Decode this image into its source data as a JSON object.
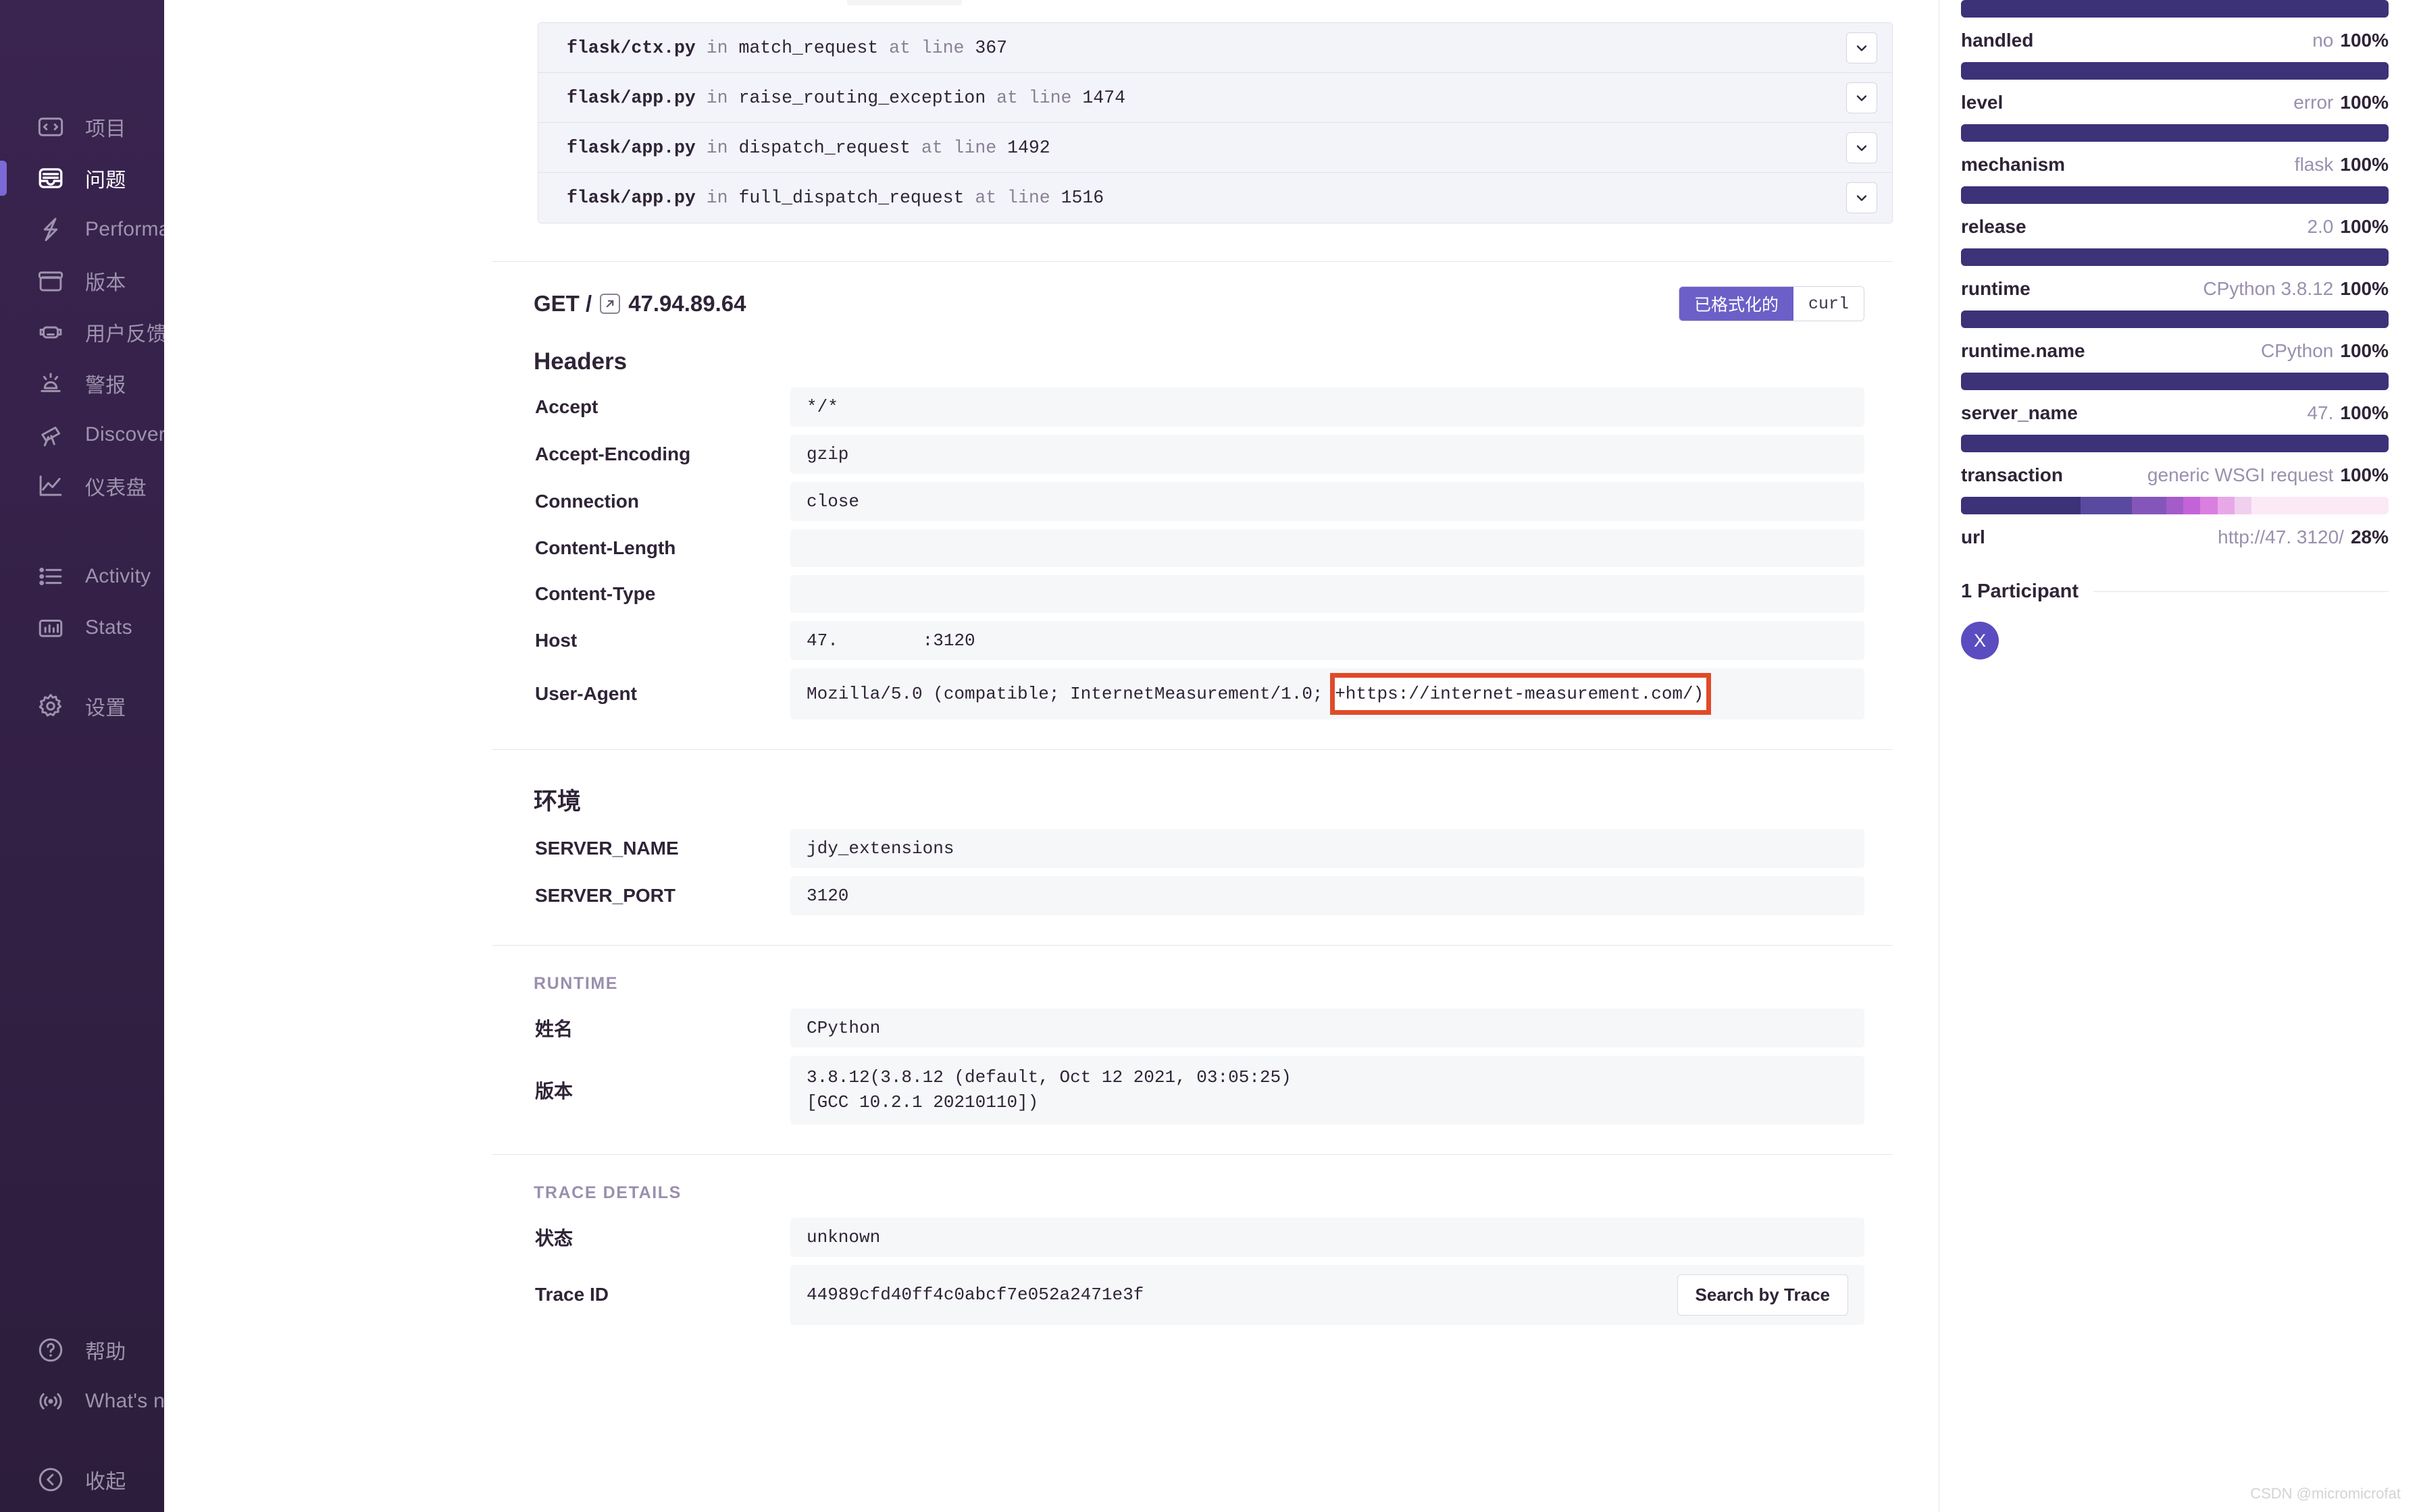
{
  "sidebar": {
    "primary_items": [
      {
        "label": "项目",
        "icon": "projects-icon",
        "active": false
      },
      {
        "label": "问题",
        "icon": "issues-icon",
        "active": true
      },
      {
        "label": "Performance",
        "icon": "lightning-icon",
        "active": false
      },
      {
        "label": "版本",
        "icon": "releases-box-icon",
        "active": false
      },
      {
        "label": "用户反馈",
        "icon": "user-feedback-icon",
        "active": false
      },
      {
        "label": "警报",
        "icon": "siren-alert-icon",
        "active": false
      },
      {
        "label": "Discover",
        "icon": "telescope-icon",
        "active": false
      },
      {
        "label": "仪表盘",
        "icon": "dashboard-chart-icon",
        "active": false
      }
    ],
    "secondary_items": [
      {
        "label": "Activity",
        "icon": "activity-list-icon",
        "active": false
      },
      {
        "label": "Stats",
        "icon": "stats-bars-icon",
        "active": false
      }
    ],
    "tertiary_items": [
      {
        "label": "设置",
        "icon": "gear-icon",
        "active": false
      }
    ],
    "bottom_items": [
      {
        "label": "帮助",
        "icon": "question-circle-icon"
      },
      {
        "label": "What's new",
        "icon": "broadcast-icon"
      },
      {
        "label": "收起",
        "icon": "chevron-left-circle-icon"
      }
    ]
  },
  "stack_frames": [
    {
      "file": "flask/ctx.py",
      "in": "in",
      "func": "match_request",
      "at": "at line",
      "line": "367"
    },
    {
      "file": "flask/app.py",
      "in": "in",
      "func": "raise_routing_exception",
      "at": "at line",
      "line": "1474"
    },
    {
      "file": "flask/app.py",
      "in": "in",
      "func": "dispatch_request",
      "at": "at line",
      "line": "1492"
    },
    {
      "file": "flask/app.py",
      "in": "in",
      "func": "full_dispatch_request",
      "at": "at line",
      "line": "1516"
    }
  ],
  "request": {
    "method_path": "GET /",
    "host": "47.94.89.64",
    "toggle": {
      "formatted": "已格式化的",
      "curl": "curl",
      "selected": "已格式化的"
    },
    "headers_title": "Headers",
    "headers": [
      {
        "key": "Accept",
        "value": "*/*"
      },
      {
        "key": "Accept-Encoding",
        "value": "gzip"
      },
      {
        "key": "Connection",
        "value": "close"
      },
      {
        "key": "Content-Length",
        "value": ""
      },
      {
        "key": "Content-Type",
        "value": ""
      },
      {
        "key": "Host",
        "value": "47.        :3120"
      }
    ],
    "user_agent": {
      "key": "User-Agent",
      "value_prefix": "Mozilla/5.0 (compatible; InternetMeasurement/1.0; ",
      "value_highlighted": "+https://internet-measurement.com/)"
    }
  },
  "environment": {
    "title": "环境",
    "rows": [
      {
        "key": "SERVER_NAME",
        "value": "jdy_extensions"
      },
      {
        "key": "SERVER_PORT",
        "value": "3120"
      }
    ]
  },
  "runtime": {
    "title": "RUNTIME",
    "rows": [
      {
        "key": "姓名",
        "value": "CPython"
      },
      {
        "key": "版本",
        "value": "3.8.12(3.8.12 (default, Oct 12 2021, 03:05:25)\n[GCC 10.2.1 20210110])"
      }
    ]
  },
  "trace_details": {
    "title": "TRACE DETAILS",
    "rows": [
      {
        "key": "状态",
        "value": "unknown"
      },
      {
        "key": "Trace ID",
        "value": "44989cfd40ff4c0abcf7e052a2471e3f"
      }
    ],
    "search_button": "Search by Trace"
  },
  "tags": [
    {
      "name": "handled",
      "value": "no",
      "percent": "100%",
      "fill": 100
    },
    {
      "name": "level",
      "value": "error",
      "percent": "100%",
      "fill": 100
    },
    {
      "name": "mechanism",
      "value": "flask",
      "percent": "100%",
      "fill": 100
    },
    {
      "name": "release",
      "value": "2.0",
      "percent": "100%",
      "fill": 100
    },
    {
      "name": "runtime",
      "value": "CPython 3.8.12",
      "percent": "100%",
      "fill": 100
    },
    {
      "name": "runtime.name",
      "value": "CPython",
      "percent": "100%",
      "fill": 100
    },
    {
      "name": "server_name",
      "value": "47.",
      "percent": "100%",
      "fill": 100
    },
    {
      "name": "transaction",
      "value": "generic WSGI request",
      "percent": "100%",
      "fill": 100
    },
    {
      "name": "url",
      "value": "http://47.        3120/",
      "percent": "28%",
      "fill": 28
    }
  ],
  "url_tag_segments": [
    {
      "width": 28,
      "color": "#3c3278"
    },
    {
      "width": 12,
      "color": "#594aa0"
    },
    {
      "width": 8,
      "color": "#8556ba"
    },
    {
      "width": 4,
      "color": "#a45cc8"
    },
    {
      "width": 4,
      "color": "#c264d8"
    },
    {
      "width": 4,
      "color": "#d97fe0"
    },
    {
      "width": 4,
      "color": "#e8a8e8"
    },
    {
      "width": 4,
      "color": "#f1cfee"
    },
    {
      "width": 32,
      "color": "#fbeaf6"
    }
  ],
  "participants": {
    "title": "1 Participant",
    "avatars": [
      "X"
    ]
  },
  "watermark": "CSDN @micromicrofat",
  "colors": {
    "sidebar_bg": "#2f1f3d",
    "accent_purple": "#6c5fc7",
    "tag_bar": "#3c3278",
    "highlight_red": "#e04a29",
    "value_bg": "#f6f7f9"
  }
}
